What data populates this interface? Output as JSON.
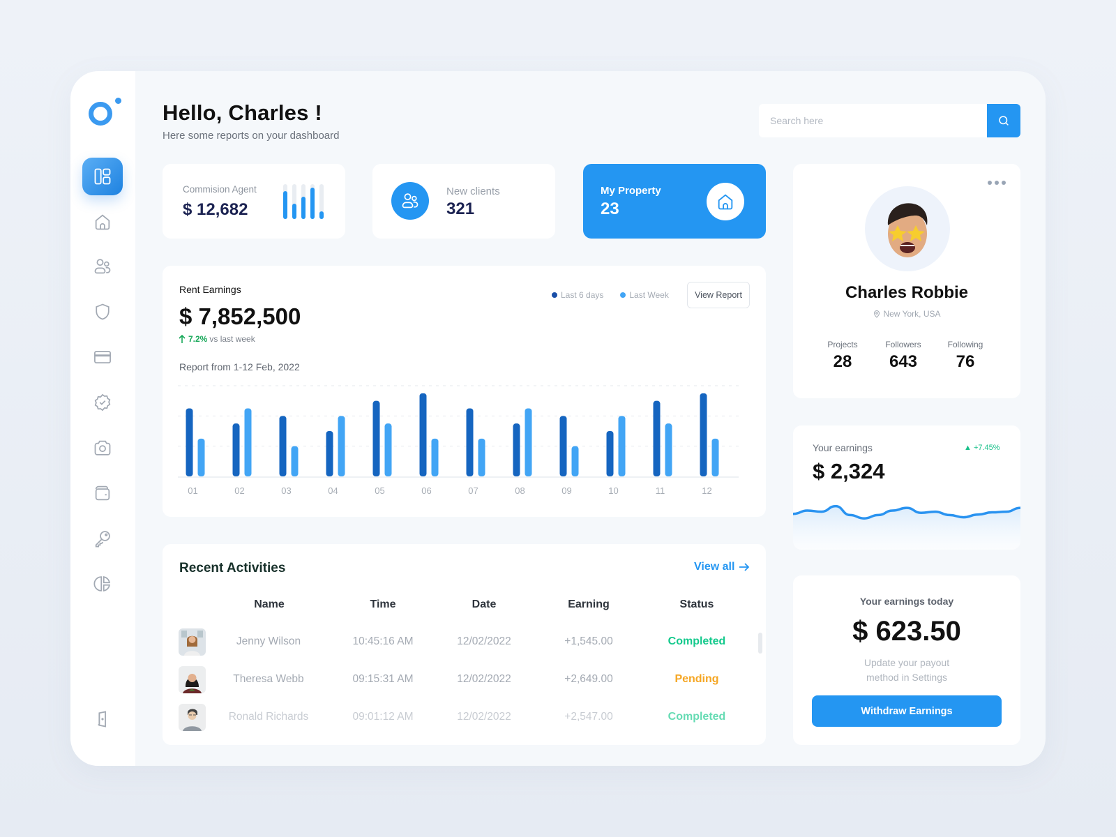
{
  "header": {
    "title": "Hello, Charles !",
    "subtitle": "Here some reports on your dashboard"
  },
  "search": {
    "placeholder": "Search here",
    "value": "",
    "icon": "search-icon"
  },
  "sidebar": {
    "logo": "app-logo",
    "items": [
      {
        "name": "dashboard",
        "icon": "dashboard-icon",
        "active": true
      },
      {
        "name": "home",
        "icon": "home-icon",
        "active": false
      },
      {
        "name": "users",
        "icon": "users-icon",
        "active": false
      },
      {
        "name": "security",
        "icon": "shield-icon",
        "active": false
      },
      {
        "name": "payments",
        "icon": "credit-card-icon",
        "active": false
      },
      {
        "name": "verified",
        "icon": "verified-badge-icon",
        "active": false
      },
      {
        "name": "camera",
        "icon": "camera-icon",
        "active": false
      },
      {
        "name": "wallet",
        "icon": "wallet-icon",
        "active": false
      },
      {
        "name": "keys",
        "icon": "key-icon",
        "active": false
      },
      {
        "name": "analytics",
        "icon": "pie-chart-icon",
        "active": false
      }
    ],
    "logout_icon": "logout-door-icon"
  },
  "stats": {
    "commission": {
      "label": "Commision Agent",
      "value": "$ 12,682",
      "mini_bars": [
        0.8,
        0.45,
        0.65,
        0.9,
        0.22
      ]
    },
    "clients": {
      "label": "New clients",
      "value": "321",
      "icon": "users-icon"
    },
    "property": {
      "label": "My Property",
      "value": "23",
      "icon": "home-icon"
    }
  },
  "rent": {
    "title": "Rent Earnings",
    "amount": "$ 7,852,500",
    "trend_pct": "7.2%",
    "trend_text": "vs last week",
    "report_range": "Report from 1-12 Feb, 2022",
    "view_report_label": "View Report",
    "colors": {
      "last6": "#1565c0",
      "lastweek": "#42a5f5"
    }
  },
  "chart_data": {
    "type": "bar",
    "title": "Rent Earnings",
    "categories": [
      "01",
      "02",
      "03",
      "04",
      "05",
      "06",
      "07",
      "08",
      "09",
      "10",
      "11",
      "12"
    ],
    "series": [
      {
        "name": "Last 6 days",
        "values": [
          90,
          70,
          80,
          60,
          100,
          110,
          90,
          70,
          80,
          60,
          100,
          110
        ]
      },
      {
        "name": "Last Week",
        "values": [
          50,
          90,
          40,
          80,
          70,
          50,
          50,
          90,
          40,
          80,
          70,
          50
        ]
      }
    ],
    "ylim": [
      0,
      120
    ],
    "grid": true,
    "legend": "top-right",
    "xlabel": "",
    "ylabel": ""
  },
  "activities": {
    "title": "Recent Activities",
    "view_all_label": "View all",
    "columns": [
      "Name",
      "Time",
      "Date",
      "Earning",
      "Status"
    ],
    "rows": [
      {
        "name": "Jenny Wilson",
        "time": "10:45:16 AM",
        "date": "12/02/2022",
        "earning": "+1,545.00",
        "status": "Completed",
        "status_color": "#14c98c"
      },
      {
        "name": "Theresa Webb",
        "time": "09:15:31 AM",
        "date": "12/02/2022",
        "earning": "+2,649.00",
        "status": "Pending",
        "status_color": "#f5a623"
      },
      {
        "name": "Ronald Richards",
        "time": "09:01:12 AM",
        "date": "12/02/2022",
        "earning": "+2,547.00",
        "status": "Completed",
        "status_color": "#14c98c"
      }
    ]
  },
  "profile": {
    "name": "Charles Robbie",
    "location": "New York, USA",
    "stats": [
      {
        "label": "Projects",
        "value": "28"
      },
      {
        "label": "Followers",
        "value": "643"
      },
      {
        "label": "Following",
        "value": "76"
      }
    ]
  },
  "earnings": {
    "label": "Your earnings",
    "value": "$ 2,324",
    "change": "+7.45%",
    "sparkline": [
      0.35,
      0.5,
      0.45,
      0.7,
      0.3,
      0.15,
      0.3,
      0.5,
      0.62,
      0.4,
      0.45,
      0.3,
      0.2,
      0.32,
      0.42,
      0.45,
      0.62
    ]
  },
  "today": {
    "label": "Your earnings today",
    "value": "$ 623.50",
    "note_line1": "Update your payout",
    "note_line2": "method in Settings",
    "button_label": "Withdraw Earnings"
  }
}
